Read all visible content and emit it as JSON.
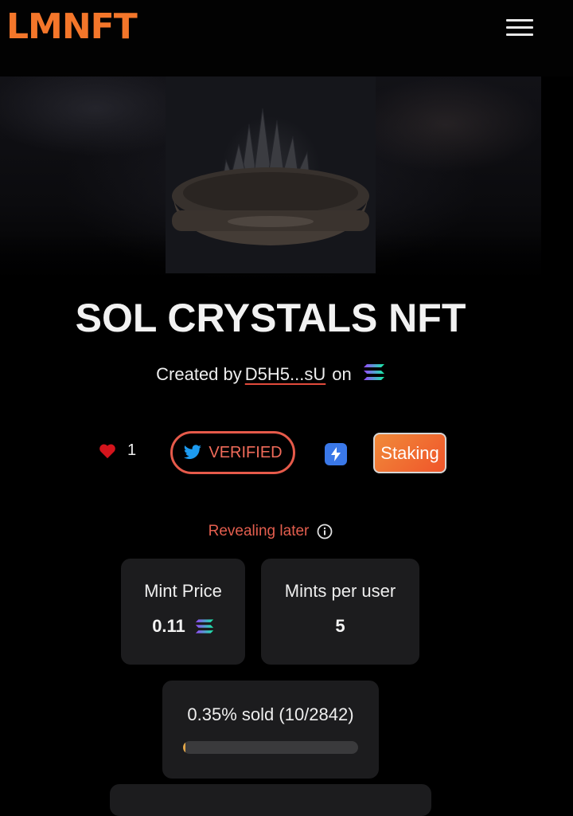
{
  "header": {
    "logo": "LMNFT",
    "menu_icon": "hamburger-menu-icon"
  },
  "collection": {
    "title": "SOL CRYSTALS NFT",
    "created_by_label": "Created by",
    "creator_address": "D5H5...sU",
    "on_label": "on",
    "chain_icon": "solana-icon"
  },
  "actions": {
    "likes_count": "1",
    "verified_label": "VERIFIED",
    "staking_label": "Staking"
  },
  "reveal": {
    "label": "Revealing later"
  },
  "stats": {
    "mint_price_label": "Mint Price",
    "mint_price_value": "0.11",
    "mints_per_user_label": "Mints per user",
    "mints_per_user_value": "5",
    "sold_label": "0.35% sold (10/2842)",
    "sold_fraction": 0.0035
  },
  "colors": {
    "brand": "#f4762a",
    "accent_red": "#e35e4e",
    "card_bg": "#1c1c1e"
  }
}
